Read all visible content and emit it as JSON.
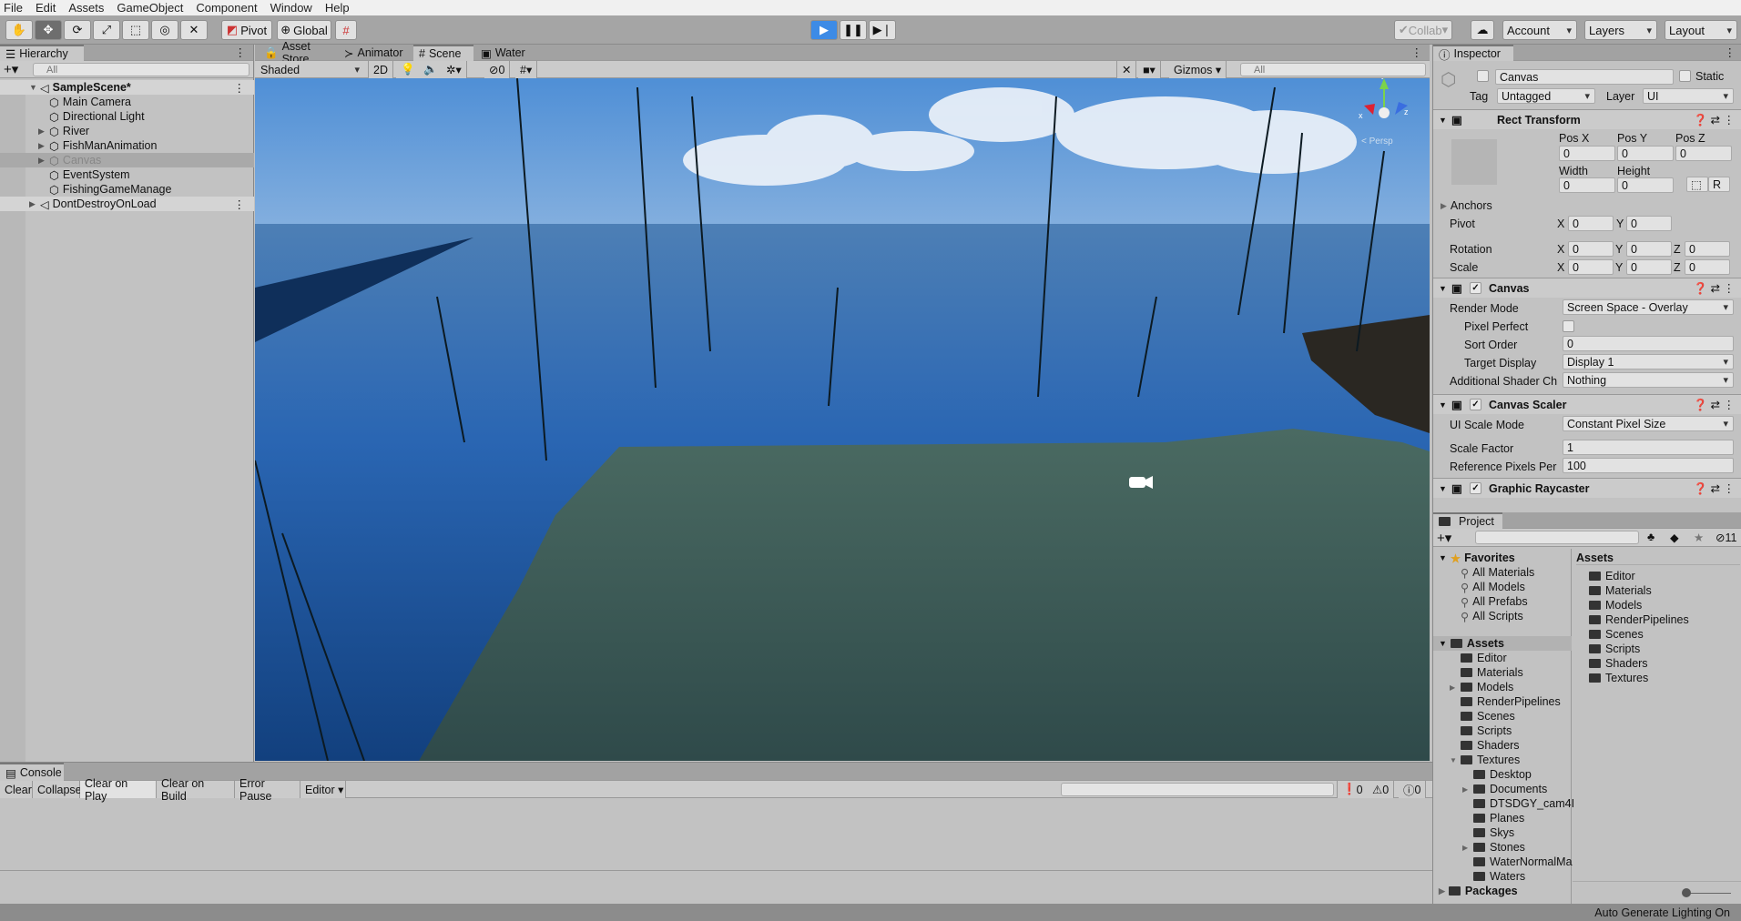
{
  "menu": [
    "File",
    "Edit",
    "Assets",
    "GameObject",
    "Component",
    "Window",
    "Help"
  ],
  "toolbar": {
    "pivot": "Pivot",
    "global": "Global",
    "collab": "Collab",
    "account": "Account",
    "layers": "Layers",
    "layout": "Layout",
    "tools": [
      "hand-icon",
      "move-icon",
      "rotate-icon",
      "scale-icon",
      "rect-icon",
      "transform-icon",
      "custom-tool-icon"
    ]
  },
  "hierarchy": {
    "title": "Hierarchy",
    "search_placeholder": "All",
    "items": [
      {
        "label": "SampleScene*",
        "level": 0,
        "kind": "scene",
        "expanded": true,
        "bold": true
      },
      {
        "label": "Main Camera",
        "level": 1
      },
      {
        "label": "Directional Light",
        "level": 1
      },
      {
        "label": "River",
        "level": 1,
        "collapsed": true
      },
      {
        "label": "FishManAnimation",
        "level": 1,
        "collapsed": true
      },
      {
        "label": "Canvas",
        "level": 1,
        "collapsed": true,
        "selected": true,
        "disabled": true
      },
      {
        "label": "EventSystem",
        "level": 1
      },
      {
        "label": "FishingGameManage",
        "level": 1
      },
      {
        "label": "DontDestroyOnLoad",
        "level": 0,
        "kind": "scene",
        "collapsed": true
      }
    ]
  },
  "scene": {
    "tabs": [
      "Asset Store",
      "Animator",
      "Scene",
      "Water"
    ],
    "active_tab": "Scene",
    "shading": "Shaded",
    "mode_2d": "2D",
    "hidden_count": "0",
    "gizmos": "Gizmos",
    "search_placeholder": "All",
    "persp": "< Persp",
    "axes": {
      "x": "x",
      "y": "y",
      "z": "z"
    }
  },
  "inspector": {
    "title": "Inspector",
    "object_name": "Canvas",
    "static": "Static",
    "tag_label": "Tag",
    "tag": "Untagged",
    "layer_label": "Layer",
    "layer": "UI",
    "rect": {
      "title": "Rect Transform",
      "posx_l": "Pos X",
      "posy_l": "Pos Y",
      "posz_l": "Pos Z",
      "posx": "0",
      "posy": "0",
      "posz": "0",
      "width_l": "Width",
      "height_l": "Height",
      "width": "0",
      "height": "0",
      "r": "R",
      "anchors": "Anchors",
      "pivot": "Pivot",
      "pivot_x": "0",
      "pivot_y": "0",
      "rotation": "Rotation",
      "rot_x": "0",
      "rot_y": "0",
      "rot_z": "0",
      "scale": "Scale",
      "sc_x": "0",
      "sc_y": "0",
      "sc_z": "0",
      "X": "X",
      "Y": "Y",
      "Z": "Z"
    },
    "canvas": {
      "title": "Canvas",
      "render_mode_l": "Render Mode",
      "render_mode": "Screen Space - Overlay",
      "pixel_perfect_l": "Pixel Perfect",
      "sort_order_l": "Sort Order",
      "sort_order": "0",
      "target_display_l": "Target Display",
      "target_display": "Display 1",
      "shader_l": "Additional Shader Ch",
      "shader": "Nothing"
    },
    "scaler": {
      "title": "Canvas Scaler",
      "mode_l": "UI Scale Mode",
      "mode": "Constant Pixel Size",
      "factor_l": "Scale Factor",
      "factor": "1",
      "ref_l": "Reference Pixels Per",
      "ref": "100"
    },
    "raycaster": {
      "title": "Graphic Raycaster"
    }
  },
  "project": {
    "title": "Project",
    "hidden_count": "11",
    "favorites": "Favorites",
    "fav_items": [
      "All Materials",
      "All Models",
      "All Prefabs",
      "All Scripts"
    ],
    "assets": "Assets",
    "tree": [
      {
        "label": "Editor",
        "level": 1
      },
      {
        "label": "Materials",
        "level": 1
      },
      {
        "label": "Models",
        "level": 1,
        "arrow": "▶"
      },
      {
        "label": "RenderPipelines",
        "level": 1
      },
      {
        "label": "Scenes",
        "level": 1
      },
      {
        "label": "Scripts",
        "level": 1
      },
      {
        "label": "Shaders",
        "level": 1
      },
      {
        "label": "Textures",
        "level": 1,
        "arrow": "▼"
      },
      {
        "label": "Desktop",
        "level": 2
      },
      {
        "label": "Documents",
        "level": 2,
        "arrow": "▶"
      },
      {
        "label": "DTSDGY_cam4I",
        "level": 2
      },
      {
        "label": "Planes",
        "level": 2
      },
      {
        "label": "Skys",
        "level": 2
      },
      {
        "label": "Stones",
        "level": 2,
        "arrow": "▶"
      },
      {
        "label": "WaterNormalMa",
        "level": 2
      },
      {
        "label": "Waters",
        "level": 2
      }
    ],
    "packages": "Packages",
    "grid_title": "Assets",
    "grid_items": [
      "Editor",
      "Materials",
      "Models",
      "RenderPipelines",
      "Scenes",
      "Scripts",
      "Shaders",
      "Textures"
    ]
  },
  "console": {
    "title": "Console",
    "buttons": [
      "Clear",
      "Collapse",
      "Clear on Play",
      "Clear on Build",
      "Error Pause",
      "Editor"
    ],
    "active": "Clear on Play",
    "errors": "0",
    "warnings": "0",
    "infos": "0"
  },
  "status": "Auto Generate Lighting On",
  "colors": {
    "play_accent": "#3d8be6",
    "sky": "#5d97d8",
    "water": "#1f5aa8",
    "ground": "#3c5a55"
  }
}
